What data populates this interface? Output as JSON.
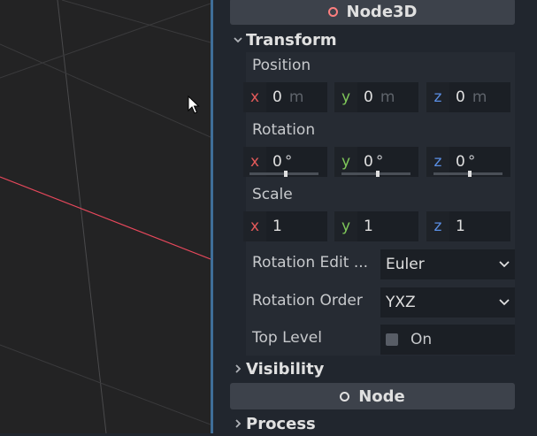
{
  "inspector": {
    "node3d_header": {
      "label": "Node3D",
      "icon": "node3d-ring-icon",
      "icon_color": "#fc7f7f"
    },
    "transform": {
      "label": "Transform",
      "position": {
        "label": "Position",
        "x": {
          "axis": "x",
          "value": "0",
          "unit": "m"
        },
        "y": {
          "axis": "y",
          "value": "0",
          "unit": "m"
        },
        "z": {
          "axis": "z",
          "value": "0",
          "unit": "m"
        }
      },
      "rotation": {
        "label": "Rotation",
        "x": {
          "axis": "x",
          "value": "0",
          "unit": "°"
        },
        "y": {
          "axis": "y",
          "value": "0",
          "unit": "°"
        },
        "z": {
          "axis": "z",
          "value": "0",
          "unit": "°"
        }
      },
      "scale": {
        "label": "Scale",
        "x": {
          "axis": "x",
          "value": "1"
        },
        "y": {
          "axis": "y",
          "value": "1"
        },
        "z": {
          "axis": "z",
          "value": "1"
        }
      },
      "rotation_edit_mode": {
        "label": "Rotation Edit ...",
        "value": "Euler"
      },
      "rotation_order": {
        "label": "Rotation Order",
        "value": "YXZ"
      },
      "top_level": {
        "label": "Top Level",
        "checkbox_label": "On",
        "checked": false
      }
    },
    "visibility": {
      "label": "Visibility"
    },
    "node_header": {
      "label": "Node",
      "icon": "node-ring-icon",
      "icon_color": "#e0e0e0"
    },
    "process": {
      "label": "Process"
    }
  },
  "colors": {
    "axis_x": "#e35a5a",
    "axis_y": "#7fc75a",
    "axis_z": "#5a8ee3",
    "viewport_bg": "#232324",
    "panel_bg": "#21262e",
    "accent": "#3f6e99"
  }
}
